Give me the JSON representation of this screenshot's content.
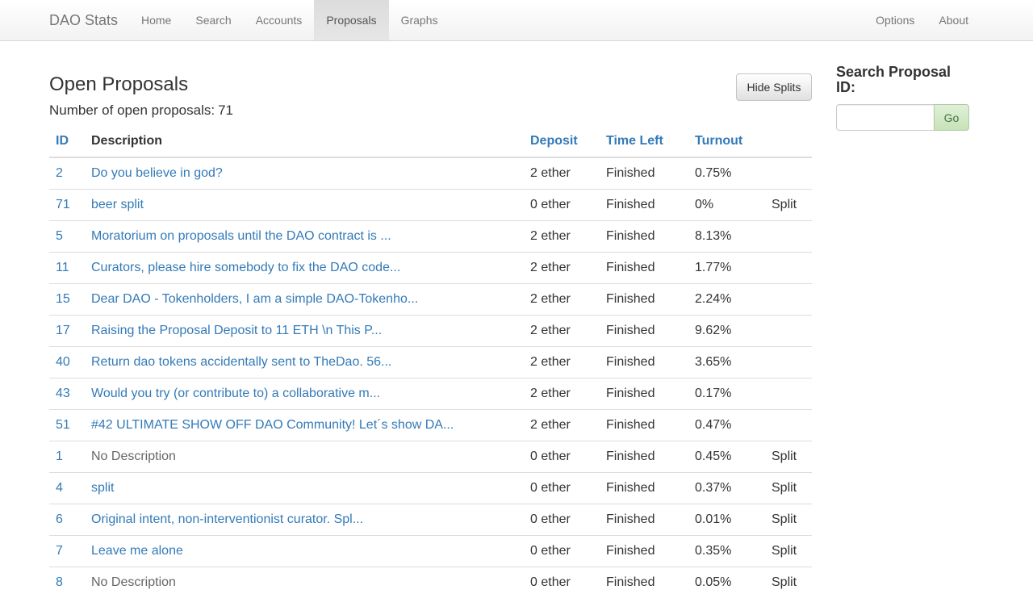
{
  "navbar": {
    "brand": "DAO Stats",
    "left_items": [
      "Home",
      "Search",
      "Accounts",
      "Proposals",
      "Graphs"
    ],
    "active_item": "Proposals",
    "right_items": [
      "Options",
      "About"
    ]
  },
  "main": {
    "title": "Open Proposals",
    "count_label": "Number of open proposals:",
    "count_value": "71",
    "hide_splits_label": "Hide Splits"
  },
  "table": {
    "headers": {
      "id": "ID",
      "description": "Description",
      "deposit": "Deposit",
      "time_left": "Time Left",
      "turnout": "Turnout"
    },
    "rows": [
      {
        "id": "2",
        "description": "Do you believe in god?",
        "deposit": "2 ether",
        "time_left": "Finished",
        "turnout": "0.75%",
        "split": ""
      },
      {
        "id": "71",
        "description": "beer split",
        "deposit": "0 ether",
        "time_left": "Finished",
        "turnout": "0%",
        "split": "Split"
      },
      {
        "id": "5",
        "description": "Moratorium on proposals until the DAO contract is ...",
        "deposit": "2 ether",
        "time_left": "Finished",
        "turnout": "8.13%",
        "split": ""
      },
      {
        "id": "11",
        "description": "Curators, please hire somebody to fix the DAO code...",
        "deposit": "2 ether",
        "time_left": "Finished",
        "turnout": "1.77%",
        "split": ""
      },
      {
        "id": "15",
        "description": "Dear DAO - Tokenholders, I am a simple DAO-Tokenho...",
        "deposit": "2 ether",
        "time_left": "Finished",
        "turnout": "2.24%",
        "split": ""
      },
      {
        "id": "17",
        "description": "Raising the Proposal Deposit to 11 ETH \\n This P...",
        "deposit": "2 ether",
        "time_left": "Finished",
        "turnout": "9.62%",
        "split": ""
      },
      {
        "id": "40",
        "description": "Return dao tokens accidentally sent to TheDao. 56...",
        "deposit": "2 ether",
        "time_left": "Finished",
        "turnout": "3.65%",
        "split": ""
      },
      {
        "id": "43",
        "description": "Would you try (or contribute to) a collaborative m...",
        "deposit": "2 ether",
        "time_left": "Finished",
        "turnout": "0.17%",
        "split": ""
      },
      {
        "id": "51",
        "description": "#42 ULTIMATE SHOW OFF DAO Community! Let´s show DA...",
        "deposit": "2 ether",
        "time_left": "Finished",
        "turnout": "0.47%",
        "split": ""
      },
      {
        "id": "1",
        "description": "No Description",
        "deposit": "0 ether",
        "time_left": "Finished",
        "turnout": "0.45%",
        "split": "Split",
        "no_description": true
      },
      {
        "id": "4",
        "description": "split",
        "deposit": "0 ether",
        "time_left": "Finished",
        "turnout": "0.37%",
        "split": "Split"
      },
      {
        "id": "6",
        "description": "Original intent, non-interventionist curator. Spl...",
        "deposit": "0 ether",
        "time_left": "Finished",
        "turnout": "0.01%",
        "split": "Split"
      },
      {
        "id": "7",
        "description": "Leave me alone",
        "deposit": "0 ether",
        "time_left": "Finished",
        "turnout": "0.35%",
        "split": "Split"
      },
      {
        "id": "8",
        "description": "No Description",
        "deposit": "0 ether",
        "time_left": "Finished",
        "turnout": "0.05%",
        "split": "Split",
        "no_description": true
      }
    ]
  },
  "sidebar": {
    "title": "Search Proposal ID:",
    "input_value": "",
    "go_label": "Go"
  },
  "colors": {
    "link": "#337ab7",
    "nav_text": "#777777",
    "go_button_bg": "#c7e2b9",
    "go_button_text": "#3c763d"
  }
}
